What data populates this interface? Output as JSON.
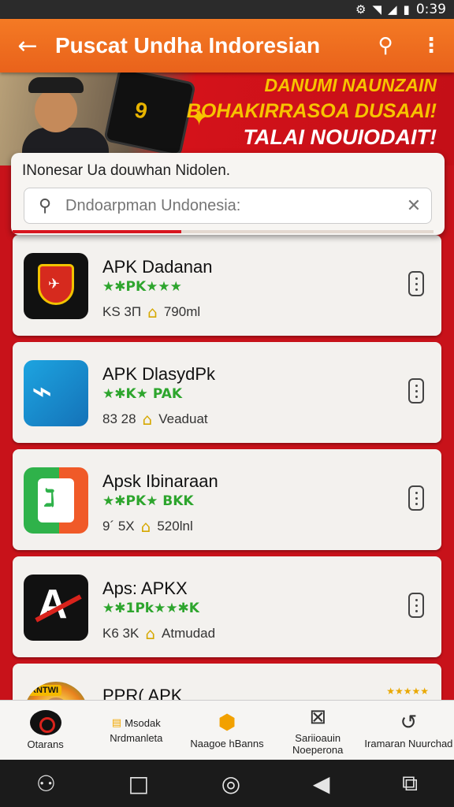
{
  "status_bar": {
    "time": "0:39",
    "icons": [
      "settings-icon",
      "wifi-icon",
      "signal-icon",
      "battery-icon"
    ]
  },
  "app_bar": {
    "title": "Puscat Undha Indoresian",
    "back_icon": "arrow-left-icon",
    "search_icon": "search-icon",
    "more_icon": "more-vert-icon",
    "color": "#f07020"
  },
  "banner": {
    "line1": "DANUMI NAUNZAIN",
    "line2": "BOHAKIRRASOA DUSAAI!",
    "line3": "TALAI NOUIODAIT!",
    "phone_logo": "9"
  },
  "search": {
    "label": "INonesar Ua douwhan Nidolen.",
    "placeholder": "Dndoarpman Undonesia:",
    "progress": 0.4
  },
  "apps": [
    {
      "name": "APK Dadanan",
      "rating": "★✱PK★★★",
      "size": "KS 3Π",
      "extra": "790ml",
      "icon": "shield-icon"
    },
    {
      "name": "APK DlasydPk",
      "rating": "★✱K★ PAK",
      "size": "83 28",
      "extra": "Veaduat",
      "icon": "map-scribble-icon"
    },
    {
      "name": "Apsk Ibinaraan",
      "rating": "★✱PK★ BKK",
      "size": "9´ 5X",
      "extra": "520lnl",
      "icon": "figure-icon"
    },
    {
      "name": "Aps: APKX",
      "rating": "★✱1Pk★★✱K",
      "size": "K6 3K",
      "extra": "Atmudad",
      "icon": "letter-a-icon"
    },
    {
      "name": "PPR( APK",
      "rating": "",
      "size": "",
      "extra": "",
      "icon": "character-badge-icon",
      "stars": "★★★★★",
      "badge": "RNTWI"
    }
  ],
  "bottom_nav": [
    {
      "label": "Otarans",
      "icon": "home-logo-icon"
    },
    {
      "label": "Nrdmanleta",
      "prefix": "Msodak",
      "icon": "news-icon"
    },
    {
      "label": "Naagoe hBanns",
      "icon": "box-icon"
    },
    {
      "label": "Sariioauin Noeperona",
      "icon": "image-frame-icon"
    },
    {
      "label": "Iramaran Nuurchad",
      "icon": "refresh-person-icon"
    }
  ],
  "system_nav": [
    "accessibility-icon",
    "square-icon",
    "home-circle-icon",
    "back-triangle-icon",
    "recents-icon"
  ]
}
